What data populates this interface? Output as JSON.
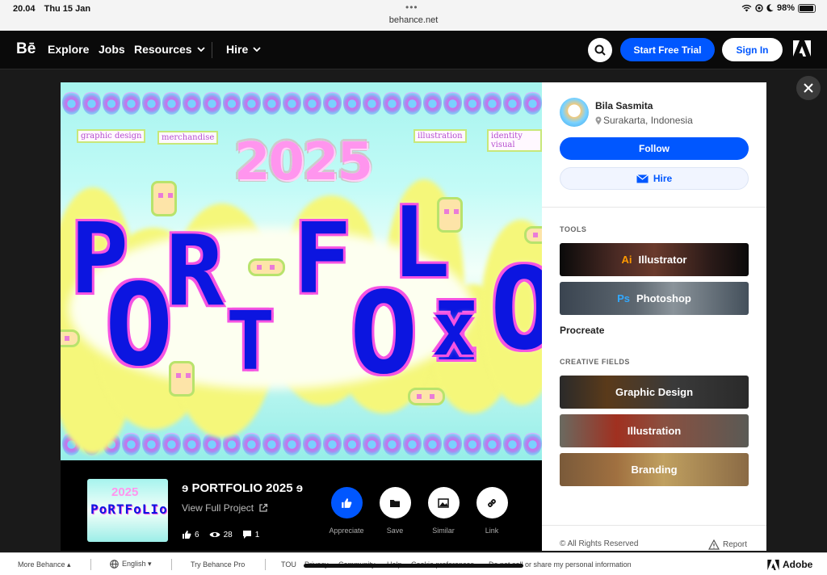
{
  "status": {
    "time": "20.04",
    "date": "Thu 15 Jan",
    "url": "behance.net",
    "battery": "98%"
  },
  "nav": {
    "logo": "Bē",
    "items": [
      "Explore",
      "Jobs",
      "Resources",
      "Hire"
    ],
    "trial_label": "Start Free Trial",
    "signin_label": "Sign In"
  },
  "project": {
    "artwork": {
      "tags": [
        "graphic design",
        "merchandise",
        "illustration",
        "identity visual"
      ],
      "year": "2025"
    },
    "title": "ɘ PORTFOLIO 2025 ɘ",
    "view_full": "View Full Project",
    "stats": {
      "appreciations": "6",
      "views": "28",
      "comments": "1"
    },
    "actions": [
      "Appreciate",
      "Save",
      "Similar",
      "Link"
    ]
  },
  "owner": {
    "name": "Bila Sasmita",
    "location": "Surakarta, Indonesia"
  },
  "sidebar": {
    "follow_label": "Follow",
    "hire_label": "Hire",
    "tools_heading": "TOOLS",
    "tools": [
      {
        "badge": "Ai",
        "label": "Illustrator",
        "badge_color": "#ff9a00"
      },
      {
        "badge": "Ps",
        "label": "Photoshop",
        "badge_color": "#31a8ff"
      }
    ],
    "plain_tool": "Procreate",
    "fields_heading": "CREATIVE FIELDS",
    "fields": [
      "Graphic Design",
      "Illustration",
      "Branding"
    ],
    "rights": "© All Rights Reserved",
    "report": "Report"
  },
  "footer": {
    "more": "More Behance ▴",
    "language": "English ▾",
    "pro": "Try Behance Pro",
    "links": [
      "TOU",
      "Privacy",
      "Community",
      "Help",
      "Cookie preferences",
      "Do not sell or share my personal information"
    ],
    "adobe": "Adobe"
  },
  "colors": {
    "accent": "#0057ff",
    "nav_bg": "#0a0a0a",
    "art_blue": "#0c15e0",
    "art_pink": "#f553e2"
  }
}
